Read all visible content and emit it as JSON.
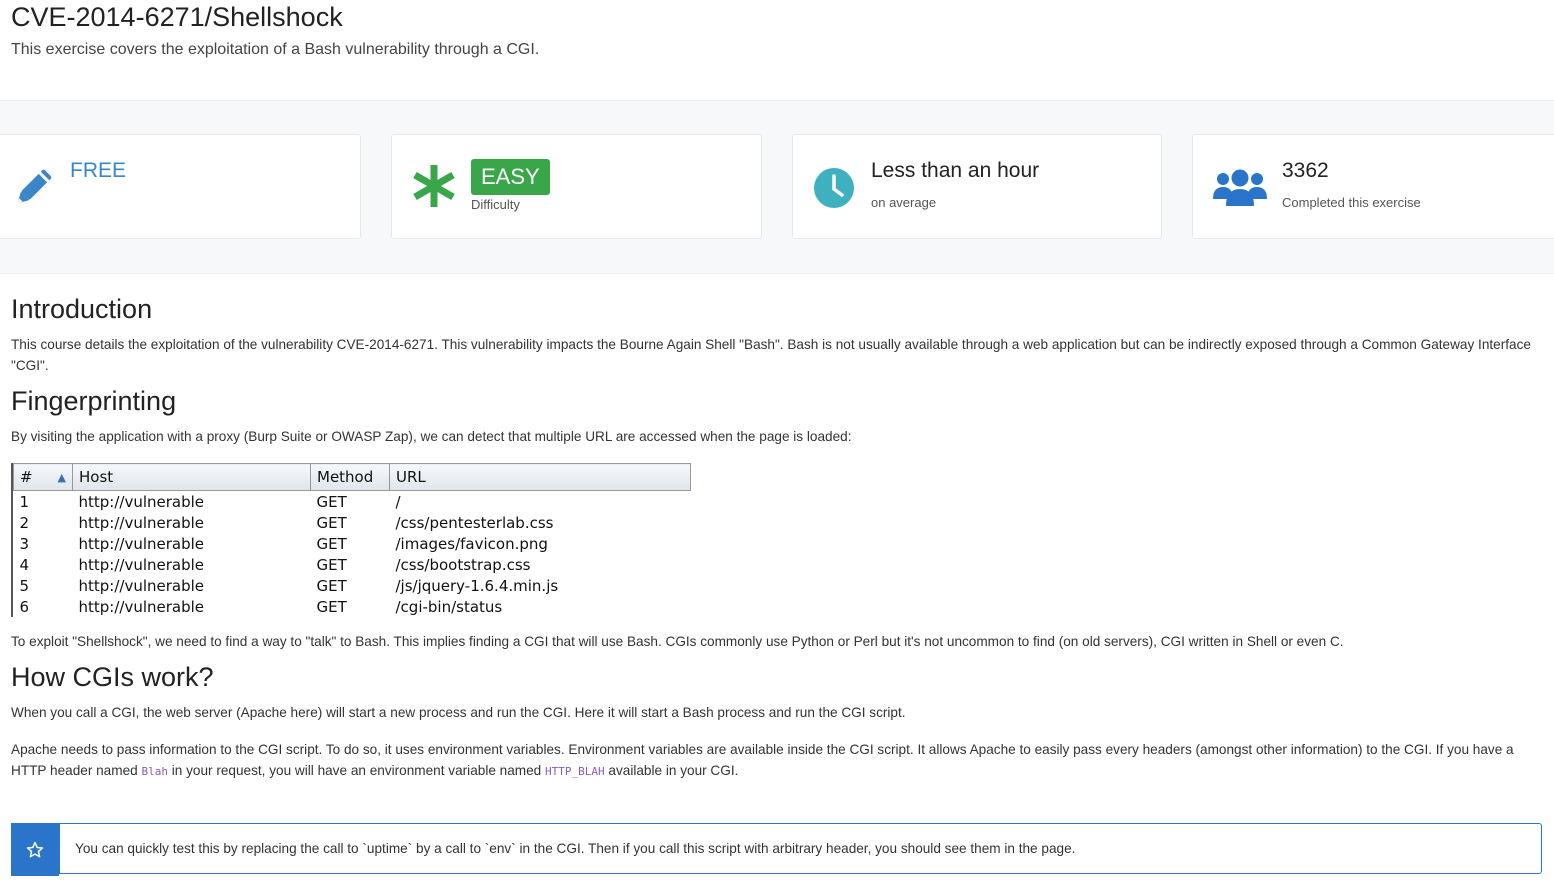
{
  "header": {
    "title": "CVE-2014-6271/Shellshock",
    "subtitle": "This exercise covers the exploitation of a Bash vulnerability through a CGI."
  },
  "stats": {
    "price": "FREE",
    "difficulty": {
      "badge": "EASY",
      "label": "Difficulty"
    },
    "time": {
      "value": "Less than an hour",
      "label": "on average"
    },
    "completed": {
      "count": "3362",
      "label": "Completed this exercise"
    }
  },
  "sections": {
    "introduction": {
      "heading": "Introduction",
      "text": "This course details the exploitation of the vulnerability CVE-2014-6271. This vulnerability impacts the Bourne Again Shell \"Bash\". Bash is not usually available through a web application but can be indirectly exposed through a Common Gateway Interface \"CGI\"."
    },
    "fingerprinting": {
      "heading": "Fingerprinting",
      "text": "By visiting the application with a proxy (Burp Suite or OWASP Zap), we can detect that multiple URL are accessed when the page is loaded:",
      "after_text": "To exploit \"Shellshock\", we need to find a way to \"talk\" to Bash. This implies finding a CGI that will use Bash. CGIs commonly use Python or Perl but it's not uncommon to find (on old servers), CGI written in Shell or even C."
    },
    "cgi": {
      "heading": "How CGIs work?",
      "p1": "When you call a CGI, the web server (Apache here) will start a new process and run the CGI. Here it will start a Bash process and run the CGI script.",
      "p2_a": "Apache needs to pass information to the CGI script. To do so, it uses environment variables. Environment variables are available inside the CGI script. It allows Apache to easily pass every headers (amongst other information) to the CGI. If you have a HTTP header named ",
      "p2_code1": "Blah",
      "p2_b": " in your request, you will have an environment variable named ",
      "p2_code2": "HTTP_BLAH",
      "p2_c": " available in your CGI."
    }
  },
  "proxy_table": {
    "columns": [
      "#",
      "Host",
      "Method",
      "URL"
    ],
    "rows": [
      [
        "1",
        "http://vulnerable",
        "GET",
        "/"
      ],
      [
        "2",
        "http://vulnerable",
        "GET",
        "/css/pentesterlab.css"
      ],
      [
        "3",
        "http://vulnerable",
        "GET",
        "/images/favicon.png"
      ],
      [
        "4",
        "http://vulnerable",
        "GET",
        "/css/bootstrap.css"
      ],
      [
        "5",
        "http://vulnerable",
        "GET",
        "/js/jquery-1.6.4.min.js"
      ],
      [
        "6",
        "http://vulnerable",
        "GET",
        "/cgi-bin/status"
      ]
    ]
  },
  "callout": {
    "icon": "star-icon",
    "text": "You can quickly test this by replacing the call to `uptime` by a call to `env` in the CGI. Then if you call this script with arbitrary header, you should see them in the page."
  },
  "colors": {
    "accent_blue": "#3a86c8",
    "easy_green": "#3aa64a",
    "clock_teal": "#3fb0c0",
    "users_blue": "#2a74c9"
  }
}
